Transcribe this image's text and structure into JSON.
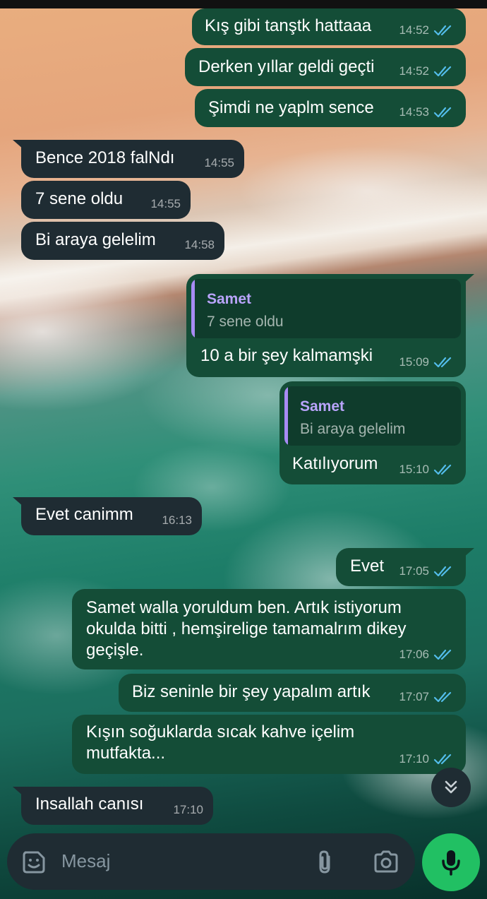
{
  "messages": [
    {
      "text": "Kış gibi tanştk hattaaa",
      "time": "14:52"
    },
    {
      "text": "Derken yıllar geldi geçti",
      "time": "14:52"
    },
    {
      "text": "Şimdi ne yaplm sence",
      "time": "14:53"
    },
    {
      "text": "Bence 2018 falNdı",
      "time": "14:55"
    },
    {
      "text": "7 sene oldu",
      "time": "14:55"
    },
    {
      "text": "Bi araya gelelim",
      "time": "14:58"
    },
    {
      "quote_author": "Samet",
      "quote_text": "7 sene oldu",
      "text": "10 a bir şey kalmamşki",
      "time": "15:09"
    },
    {
      "quote_author": "Samet",
      "quote_text": "Bi araya gelelim",
      "text": "Katılıyorum",
      "time": "15:10"
    },
    {
      "text": "Evet canimm",
      "time": "16:13"
    },
    {
      "text": "Evet",
      "time": "17:05"
    },
    {
      "text": "Samet walla yoruldum ben. Artık istiyorum okulda bitti , hemşirelige tamamalrım dikey geçişle.",
      "time": "17:06"
    },
    {
      "text": "Biz seninle bir şey yapalım artık",
      "time": "17:07"
    },
    {
      "text": "Kışın soğuklarda sıcak kahve içelim mutfakta...",
      "time": "17:10"
    },
    {
      "text": "Insallah canısı",
      "time": "17:10"
    }
  ],
  "composer": {
    "placeholder": "Mesaj"
  },
  "icons": {
    "sticker": "sticker-icon",
    "attach": "paperclip-icon",
    "camera": "camera-icon",
    "mic": "microphone-icon",
    "scroll": "double-chevron-down-icon",
    "read": "double-check-icon"
  },
  "colors": {
    "incoming": "#1f2c33",
    "outgoing": "#144d37",
    "read_ticks": "#53bdeb",
    "mic_button": "#21c063",
    "quote_author": "#b9a4fb"
  }
}
